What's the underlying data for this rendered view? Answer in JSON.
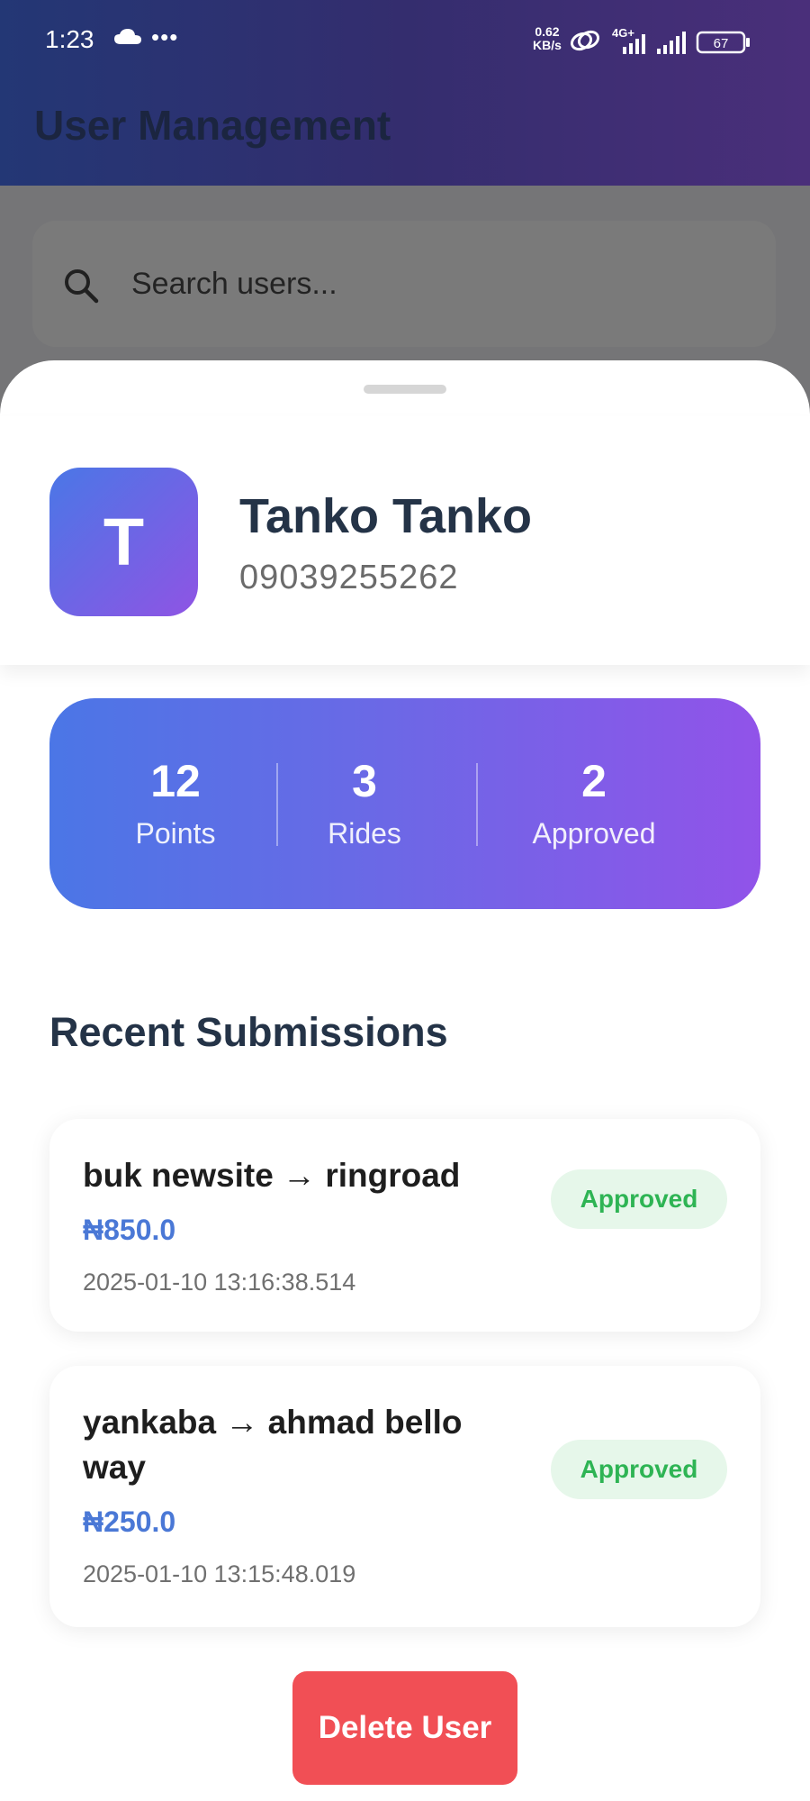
{
  "status_bar": {
    "time": "1:23",
    "dots": "•••",
    "net_speed_value": "0.62",
    "net_speed_unit": "KB/s",
    "network_type": "4G+",
    "battery": "67"
  },
  "app": {
    "title": "User Management",
    "search_placeholder": "Search users..."
  },
  "user": {
    "initial": "T",
    "name": "Tanko Tanko",
    "phone": "09039255262"
  },
  "stats": [
    {
      "value": "12",
      "label": "Points"
    },
    {
      "value": "3",
      "label": "Rides"
    },
    {
      "value": "2",
      "label": "Approved"
    }
  ],
  "submissions_title": "Recent Submissions",
  "submissions": [
    {
      "route": "buk newsite → ringroad",
      "amount": "₦850.0",
      "timestamp": "2025-01-10 13:16:38.514",
      "status": "Approved"
    },
    {
      "route": "yankaba → ahmad bello way",
      "amount": "₦250.0",
      "timestamp": "2025-01-10 13:15:48.019",
      "status": "Approved"
    }
  ],
  "actions": {
    "delete_label": "Delete User"
  },
  "colors": {
    "accent_blue": "#4a77e6",
    "accent_purple": "#8f54e4",
    "approved_green": "#2eb454",
    "delete_red": "#f14f55"
  }
}
